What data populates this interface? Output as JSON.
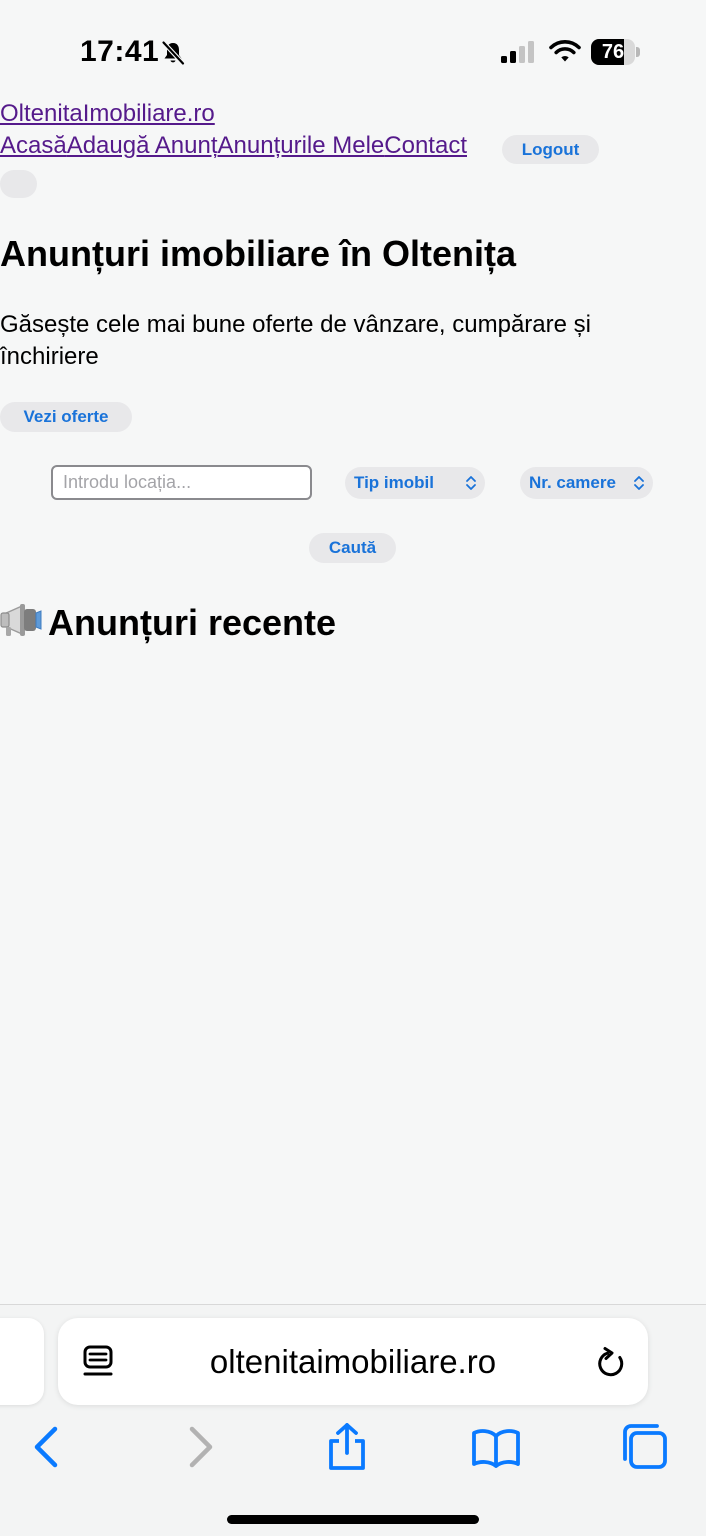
{
  "status_bar": {
    "time": "17:41",
    "battery_level": "76",
    "icons": [
      "bell-slash-icon",
      "cellular-signal-icon",
      "wifi-icon",
      "battery-icon"
    ]
  },
  "site": {
    "name": "OltenitaImobiliare.ro"
  },
  "nav": {
    "items": [
      "Acasă",
      "Adaugă Anunț",
      "Anunțurile Mele",
      "Contact"
    ],
    "logout_label": "Logout"
  },
  "hero": {
    "title": "Anunțuri imobiliare în Oltenița",
    "subtitle": "Găsește cele mai bune oferte de vânzare, cumpărare și închiriere",
    "cta_label": "Vezi oferte"
  },
  "search": {
    "location_placeholder": "Introdu locația...",
    "type_select_label": "Tip imobil",
    "rooms_select_label": "Nr. camere",
    "submit_label": "Caută"
  },
  "recent": {
    "title": "Anunțuri recente",
    "icon": "megaphone-icon"
  },
  "browser": {
    "url": "oltenitaimobiliare.ro",
    "toolbar_icons": [
      "back-icon",
      "forward-icon",
      "share-icon",
      "bookmarks-icon",
      "tabs-icon"
    ]
  },
  "colors": {
    "page_background": "#f6f7f7",
    "link_visited": "#551a8b",
    "button_text": "#1a73d9",
    "button_background": "#e8e8ea",
    "ios_accent": "#0a7aff"
  }
}
